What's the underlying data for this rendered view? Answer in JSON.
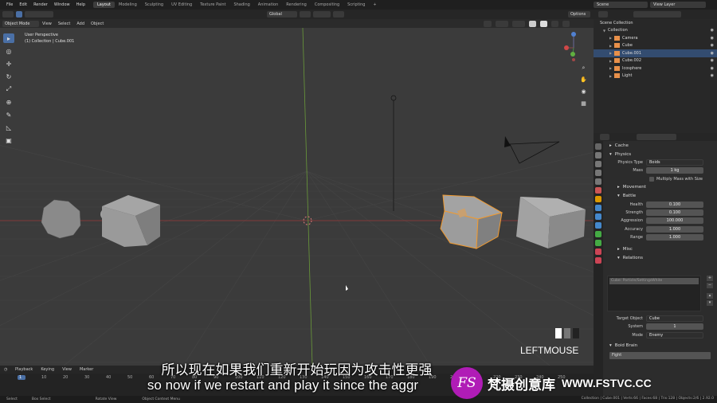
{
  "menu": [
    "File",
    "Edit",
    "Render",
    "Window",
    "Help"
  ],
  "workspaces": [
    "Layout",
    "Modeling",
    "Sculpting",
    "UV Editing",
    "Texture Paint",
    "Shading",
    "Animation",
    "Rendering",
    "Compositing",
    "Scripting",
    "+"
  ],
  "active_workspace": "Layout",
  "scene": "Scene",
  "view_layer": "View Layer",
  "header": {
    "transform": "Global",
    "options": "Options"
  },
  "viewport_menu": {
    "mode": "Object Mode",
    "items": [
      "View",
      "Select",
      "Add",
      "Object"
    ]
  },
  "viewport_info": {
    "line1": "User Perspective",
    "line2": "(1) Collection | Cube.001"
  },
  "key_overlay": "LEFTMOUSE",
  "outliner": {
    "root": "Scene Collection",
    "collection": "Collection",
    "items": [
      {
        "name": "Camera",
        "color": "#e8904a"
      },
      {
        "name": "Cube",
        "color": "#e8904a"
      },
      {
        "name": "Cube.001",
        "color": "#e8904a",
        "selected": true
      },
      {
        "name": "Cube.002",
        "color": "#e8904a"
      },
      {
        "name": "Icosphere",
        "color": "#e8904a"
      },
      {
        "name": "Light",
        "color": "#e8904a"
      }
    ]
  },
  "properties": {
    "cache": "Cache",
    "physics": "Physics",
    "physics_type_label": "Physics Type",
    "physics_type": "Boids",
    "mass_label": "Mass",
    "mass": "1 kg",
    "multiply_mass": "Multiply Mass with Size",
    "movement": "Movement",
    "battle": "Battle",
    "battle_rows": [
      {
        "label": "Health",
        "value": "0.100"
      },
      {
        "label": "Strength",
        "value": "0.100"
      },
      {
        "label": "Aggression",
        "value": "100.000"
      },
      {
        "label": "Accuracy",
        "value": "1.000"
      },
      {
        "label": "Range",
        "value": "1.000"
      }
    ],
    "misc": "Misc",
    "relations": "Relations",
    "relations_item": "Cube: Particle/SettingsWhite",
    "target_object_label": "Target Object",
    "target_object": "Cube",
    "system_label": "System",
    "system": "1",
    "mode_label": "Mode",
    "mode": "Enemy",
    "boid_brain": "Boid Brain",
    "fight": "Fight"
  },
  "timeline": {
    "menu": [
      "Playback",
      "Keying",
      "View",
      "Marker"
    ],
    "frame_numbers": [
      "1",
      "10",
      "20",
      "30",
      "40",
      "50",
      "60",
      "70",
      "80",
      "90",
      "100",
      "110",
      "120",
      "130",
      "140",
      "150",
      "160",
      "170",
      "180",
      "190",
      "200",
      "210",
      "220",
      "230",
      "240",
      "250"
    ]
  },
  "statusbar": {
    "left": [
      "Select",
      "Box Select",
      "Rotate View",
      "Object Context Menu"
    ],
    "right": "Collection | Cube.001 | Verts:66 | Faces:68 | Tris:128 | Objects:2/6 | 2.92.0"
  },
  "subtitle": {
    "zh": "所以现在如果我们重新开始玩因为攻击性更强",
    "en": "so now if we restart and play it since the aggr"
  },
  "watermark": {
    "logo": "FS",
    "name": "梵摄创意库",
    "site": "WWW.FSTVC.CC"
  }
}
